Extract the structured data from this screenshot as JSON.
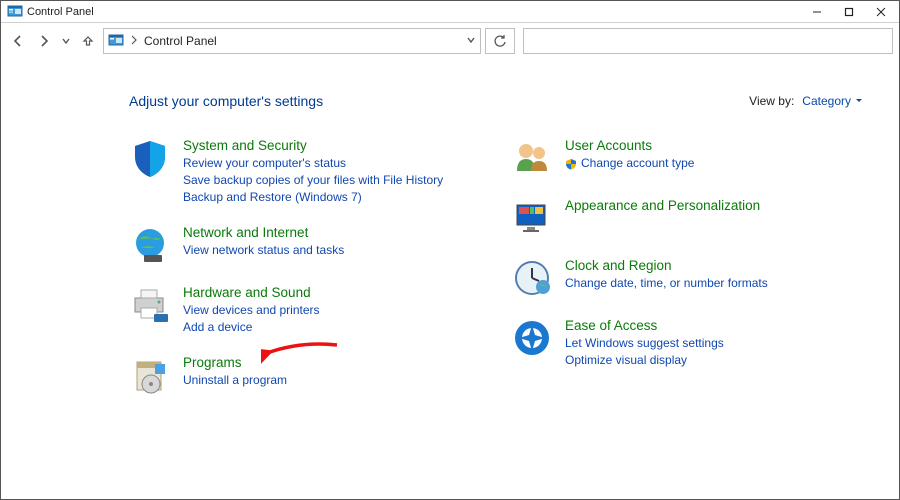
{
  "window": {
    "title": "Control Panel"
  },
  "address": {
    "location": "Control Panel"
  },
  "header": {
    "heading": "Adjust your computer's settings",
    "viewby_label": "View by:",
    "viewby_value": "Category"
  },
  "left": [
    {
      "icon": "shield-icon",
      "title": "System and Security",
      "links": [
        {
          "text": "Review your computer's status"
        },
        {
          "text": "Save backup copies of your files with File History"
        },
        {
          "text": "Backup and Restore (Windows 7)"
        }
      ]
    },
    {
      "icon": "globe-icon",
      "title": "Network and Internet",
      "links": [
        {
          "text": "View network status and tasks"
        }
      ]
    },
    {
      "icon": "printer-icon",
      "title": "Hardware and Sound",
      "links": [
        {
          "text": "View devices and printers"
        },
        {
          "text": "Add a device"
        }
      ]
    },
    {
      "icon": "box-icon",
      "title": "Programs",
      "links": [
        {
          "text": "Uninstall a program"
        }
      ]
    }
  ],
  "right": [
    {
      "icon": "people-icon",
      "title": "User Accounts",
      "links": [
        {
          "text": "Change account type",
          "shield": true
        }
      ]
    },
    {
      "icon": "monitor-icon",
      "title": "Appearance and Personalization",
      "links": []
    },
    {
      "icon": "clock-icon",
      "title": "Clock and Region",
      "links": [
        {
          "text": "Change date, time, or number formats"
        }
      ]
    },
    {
      "icon": "ease-icon",
      "title": "Ease of Access",
      "links": [
        {
          "text": "Let Windows suggest settings"
        },
        {
          "text": "Optimize visual display"
        }
      ]
    }
  ]
}
